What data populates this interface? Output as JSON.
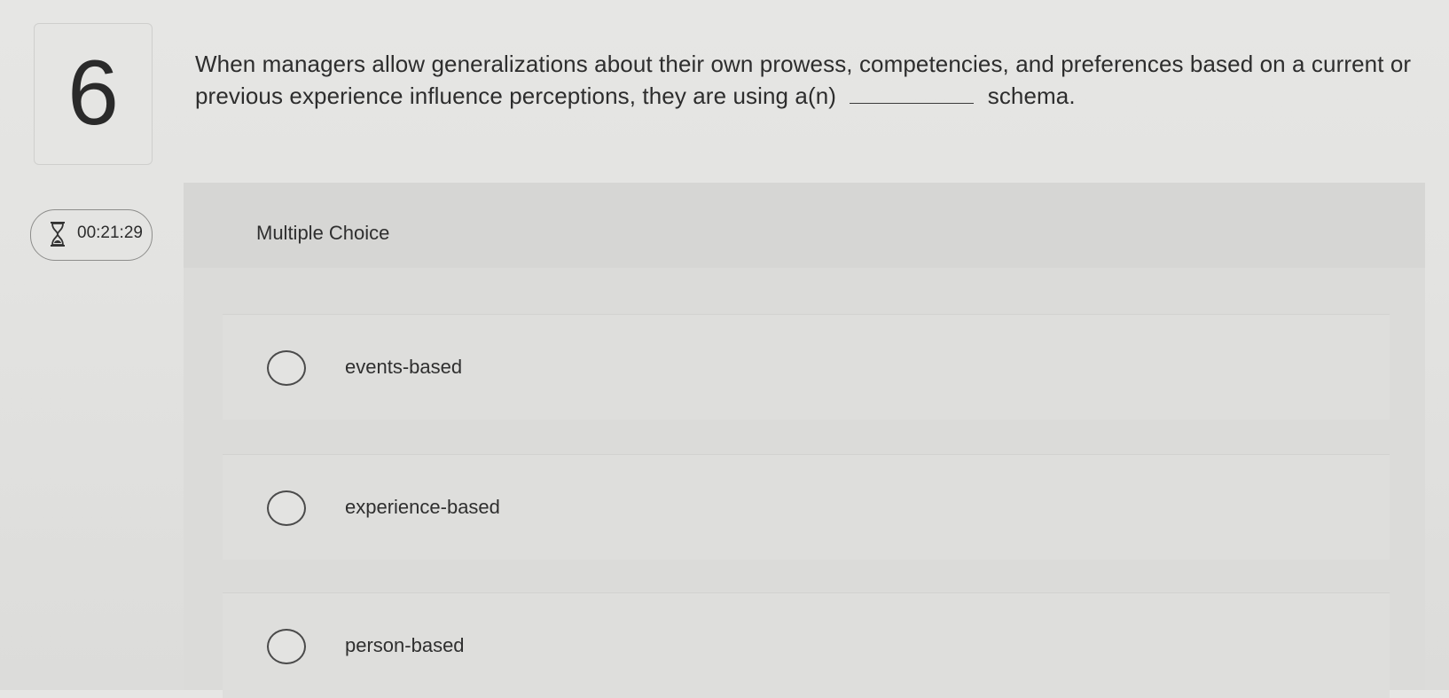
{
  "question": {
    "number": "6",
    "text_before_blank": "When managers allow generalizations about their own prowess, competencies, and preferences based on a current or previous experience influence perceptions, they are using a(n)",
    "text_after_blank": "schema."
  },
  "timer": {
    "icon": "hourglass-icon",
    "value": "00:21:29"
  },
  "multiple_choice": {
    "title": "Multiple Choice",
    "options": [
      {
        "label": "events-based"
      },
      {
        "label": "experience-based"
      },
      {
        "label": "person-based"
      }
    ]
  }
}
